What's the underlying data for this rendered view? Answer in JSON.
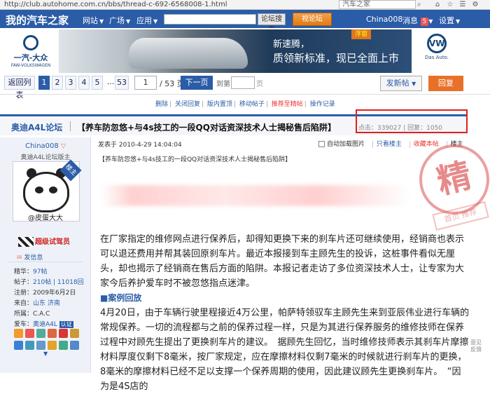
{
  "browser": {
    "url": "http://club.autohome.com.cn/bbs/thread-c-692-6568008-1.html",
    "search_value": "汽车之家"
  },
  "topnav": {
    "logo": "我的汽车之家",
    "items": [
      "网站",
      "广场",
      "应用"
    ],
    "search_button": "论坛搜索",
    "vision_button": "视论坛",
    "username": "China008",
    "messages_label": "消息",
    "messages_count": "5",
    "settings_label": "设置"
  },
  "banner": {
    "left_brand_cn": "一汽-大众",
    "left_brand_en": "FAW-VOLKSWAGEN",
    "ad_line1": "新速腾，",
    "ad_line2": "质领新标准，现已全面上市",
    "ad_badge": "浮窗",
    "right_brand_logo": "VW",
    "right_brand": "Das Auto."
  },
  "pager": {
    "back_label": "返回列表",
    "pages": [
      "1",
      "2",
      "3",
      "4",
      "5",
      "...",
      "53"
    ],
    "current_page": "1",
    "total": "/ 53 页",
    "next_label": "下一页",
    "goto_label": "到第",
    "go_label": "页",
    "new_post_label": "发新帖",
    "reply_label": "回复"
  },
  "admin_links": [
    "删除",
    "关闭回复",
    "版内置顶",
    "移动帖子",
    "推荐至精帖",
    "操作记录"
  ],
  "thread": {
    "forum": "奥迪A4L论坛",
    "title": "【养车防忽悠+与4s技工的一段QQ对话资深技术人士揭秘售后陷阱】",
    "views_label": "点击：339027",
    "replies_label": "回复：1050"
  },
  "author": {
    "name": "China008",
    "role": "奥迪A4L论坛版主",
    "ribbon": "楼主",
    "avatar_caption": "@皮蛋大大",
    "level": "超级试驾员",
    "send_message": "发信息",
    "info": [
      {
        "k": "精华：",
        "v": "97帖"
      },
      {
        "k": "帖子：",
        "v": "210帖 | 11018回"
      },
      {
        "k": "注册：",
        "v": "2009年6月2日"
      },
      {
        "k": "来自：",
        "v": "山东 济南"
      },
      {
        "k": "所属：",
        "v": "C.A.C"
      },
      {
        "k": "爱车：",
        "v": "奥迪A4L"
      }
    ],
    "car_tag": "认证"
  },
  "post": {
    "posted_at": "发表于 2010-4-29 14:04:04",
    "tools": [
      "自动加载图片",
      "只看楼主",
      "收藏本帖",
      "楼主"
    ],
    "subtitle": "【养车防忽悠+与4s技工的一段QQ对话资深技术人士揭秘售后陷阱】",
    "seal_char": "精",
    "seal_sub": "首页 推荐",
    "para1": "在厂家指定的维修网点进行保养后，却得知更换下来的刹车片还可继续使用，经销商也表示可以退还费用并帮其装回原刹车片。最近本报接到车主顾先生的投诉，这桩事件看似无厘头，却也揭示了经销商在售后方面的陷阱。本报记者走访了多位资深技术人士，让专家为大家今后养护爱车时不被忽悠指点迷津。",
    "section1": "■案例回放",
    "para2": "4月20日，由于车辆行驶里程接近4万公里，帕萨特领驭车主顾先生来到亚辰伟业进行车辆的常规保养。一切的流程都与之前的保养过程一样，只是为其进行保养服务的维修技师在保养过程中对顾先生提出了更换刹车片的建议。　据顾先生回忆，当时维修技师表示其刹车片摩擦材料厚度仅剩下8毫米，按厂家规定，应在摩擦材料仅剩7毫米的时候就进行刹车片的更换，8毫米的摩擦材料已经不足以支撑一个保养周期的使用，因此建议顾先生更换刹车片。　“因为是4S店的"
  },
  "feedback": "意见\n反馈"
}
